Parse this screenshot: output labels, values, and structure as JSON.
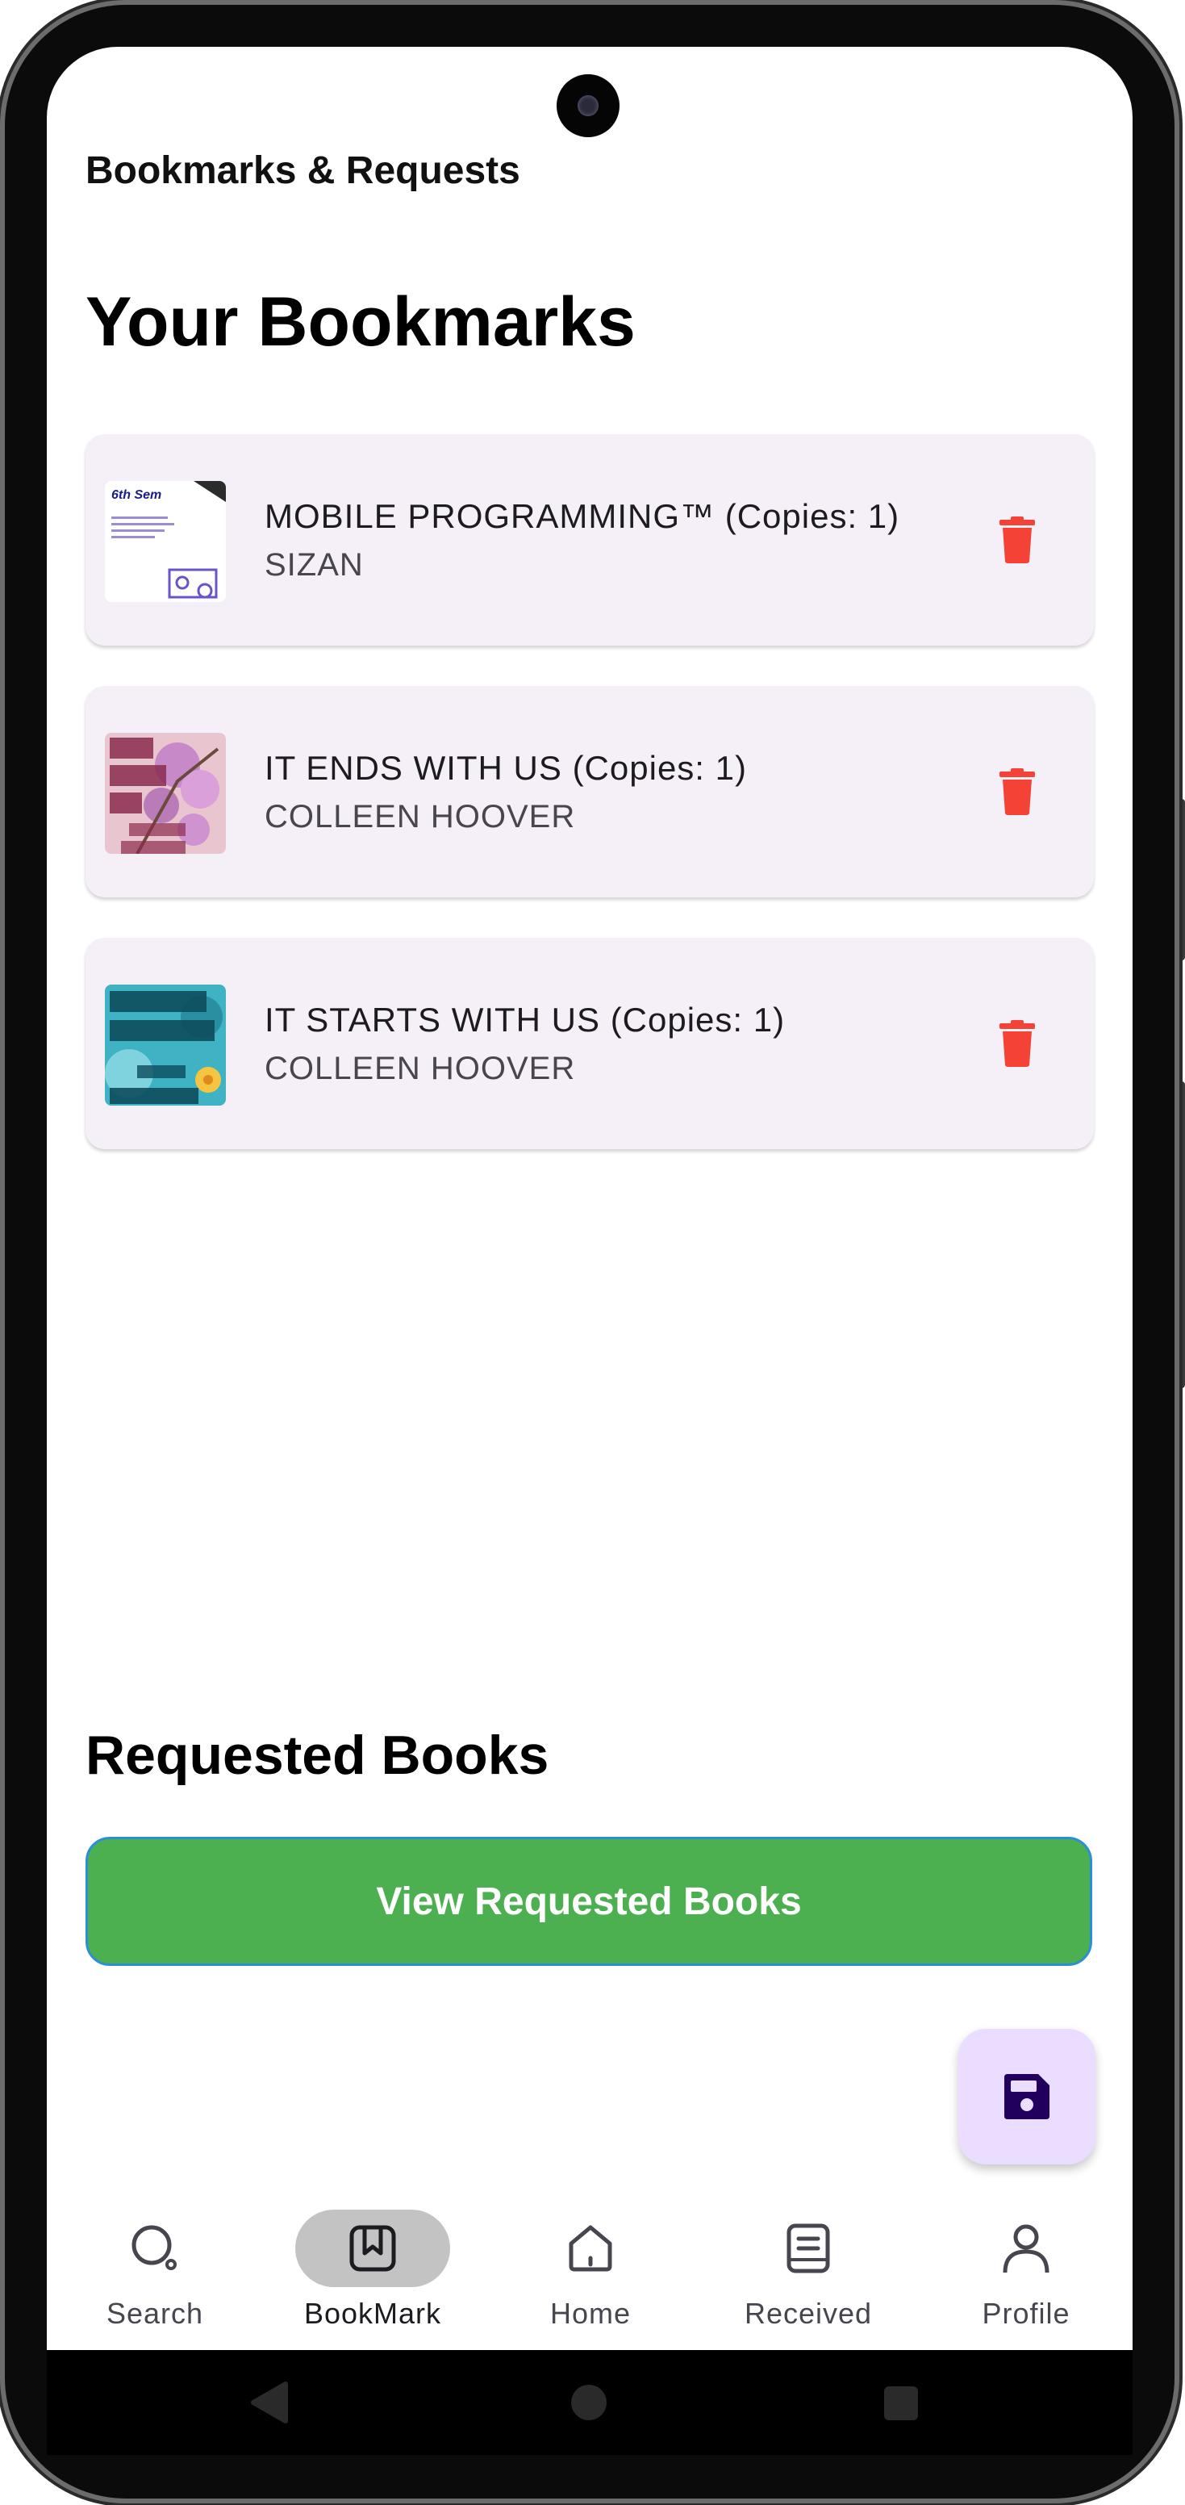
{
  "app": {
    "title": "Bookmarks & Requests"
  },
  "bookmarks": {
    "heading": "Your Bookmarks",
    "items": [
      {
        "title": "MOBILE PROGRAMMING™ (Copies: 1)",
        "author": "SIZAN",
        "cover": "mobile-programming-cover",
        "cover_text": "6th Sem"
      },
      {
        "title": "IT ENDS WITH US (Copies: 1)",
        "author": "COLLEEN HOOVER",
        "cover": "it-ends-with-us-cover"
      },
      {
        "title": "IT STARTS WITH US (Copies: 1)",
        "author": "COLLEEN HOOVER",
        "cover": "it-starts-with-us-cover"
      }
    ],
    "delete_icon": "trash-icon"
  },
  "requests": {
    "heading": "Requested Books",
    "view_button_label": "View Requested Books"
  },
  "fab": {
    "icon": "save-icon"
  },
  "bottom_nav": {
    "items": [
      {
        "label": "Search",
        "icon": "search-icon",
        "active": false
      },
      {
        "label": "BookMark",
        "icon": "bookmark-icon",
        "active": true
      },
      {
        "label": "Home",
        "icon": "home-icon",
        "active": false
      },
      {
        "label": "Received",
        "icon": "book-icon",
        "active": false
      },
      {
        "label": "Profile",
        "icon": "person-icon",
        "active": false
      }
    ]
  },
  "colors": {
    "card_bg": "#f5eff7",
    "delete_red": "#f44336",
    "primary_button": "#4caf50",
    "fab_bg": "#eaddff",
    "fab_icon": "#21005d",
    "nav_active_pill": "#c3c3c3"
  }
}
